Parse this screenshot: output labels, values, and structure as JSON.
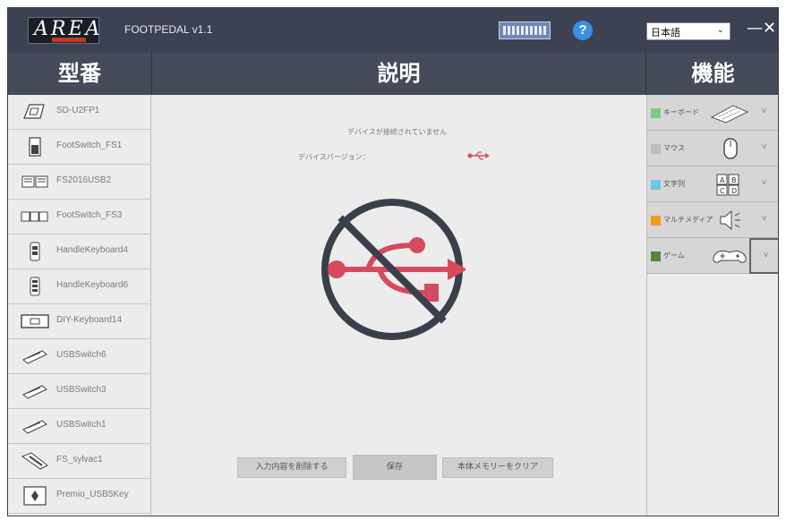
{
  "window": {
    "logo_text": "AREA",
    "app_title": "FOOTPEDAL v1.1",
    "language": "日本語",
    "minimize": "—",
    "close": "✕"
  },
  "headers": {
    "models": "型番",
    "description": "説明",
    "functions": "機能"
  },
  "models": [
    {
      "label": "SD-U2FP1",
      "icon": "pedal-icon"
    },
    {
      "label": "FootSwitch_FS1",
      "icon": "footswitch-icon"
    },
    {
      "label": "FS2016USB2",
      "icon": "double-pedal-icon"
    },
    {
      "label": "FootSwitch_FS3",
      "icon": "triple-pedal-icon"
    },
    {
      "label": "HandleKeyboard4",
      "icon": "handle-keyboard-icon"
    },
    {
      "label": "HandleKeyboard6",
      "icon": "handle-keyboard-icon"
    },
    {
      "label": "DIY-Keyboard14",
      "icon": "diy-keyboard-icon"
    },
    {
      "label": "USBSwitch6",
      "icon": "usb-switch-icon"
    },
    {
      "label": "USBSwitch3",
      "icon": "usb-switch-icon"
    },
    {
      "label": "USBSwitch1",
      "icon": "usb-switch-icon"
    },
    {
      "label": "FS_sylvac1",
      "icon": "sylvac-icon"
    },
    {
      "label": "Premio_USB5Key",
      "icon": "five-key-icon"
    }
  ],
  "description": {
    "status": "デバイスが接続されていません",
    "version_label": "デバイスバージョン：",
    "buttons": {
      "delete": "入力内容を削除する",
      "save": "保存",
      "clear": "本体メモリーをクリア"
    }
  },
  "functions": [
    {
      "label": "キーボード",
      "color": "#7fc97f",
      "icon": "keyboard-icon"
    },
    {
      "label": "マウス",
      "color": "#bdbdbd",
      "icon": "mouse-icon"
    },
    {
      "label": "文字列",
      "color": "#6ec6e8",
      "icon": "abcd-icon"
    },
    {
      "label": "マルチメディア",
      "color": "#f39c12",
      "icon": "speaker-icon"
    },
    {
      "label": "ゲーム",
      "color": "#4f8a3a",
      "icon": "gamepad-icon"
    }
  ],
  "colors": {
    "accent_red": "#d64a5c",
    "no_usb_ring": "#3a3f4c",
    "header_bg": "#464b5a",
    "titlebar_bg": "#3c4252"
  }
}
